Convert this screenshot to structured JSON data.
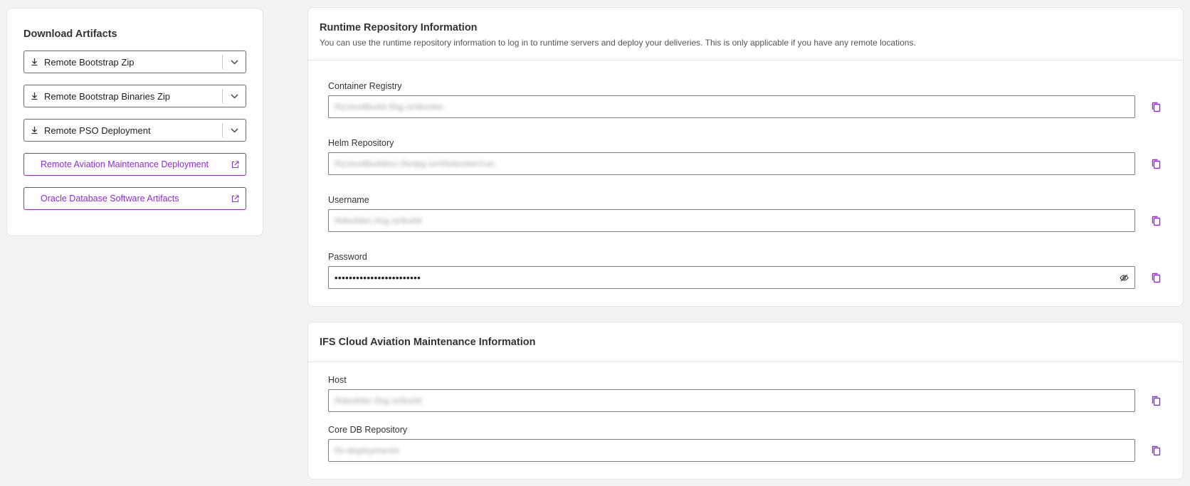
{
  "colors": {
    "accent": "#8a2fd1",
    "background": "#f3f2f4",
    "card": "#ffffff"
  },
  "download_artifacts": {
    "title": "Download Artifacts",
    "split_buttons": [
      {
        "label": "Remote Bootstrap Zip",
        "icon": "download-icon",
        "menu_icon": "chevron-down-icon"
      },
      {
        "label": "Remote Bootstrap Binaries Zip",
        "icon": "download-icon",
        "menu_icon": "chevron-down-icon"
      },
      {
        "label": "Remote PSO Deployment",
        "icon": "download-icon",
        "menu_icon": "chevron-down-icon"
      }
    ],
    "link_buttons": [
      {
        "label": "Remote Aviation Maintenance Deployment",
        "icon": "external-link-icon"
      },
      {
        "label": "Oracle Database Software Artifacts",
        "icon": "external-link-icon"
      }
    ]
  },
  "runtime_repository": {
    "title": "Runtime Repository Information",
    "description": "You can use the runtime repository information to log in to runtime servers and deploy your deliveries. This is only applicable if you have any remote locations.",
    "fields": [
      {
        "label": "Container Registry",
        "value": "ifscloudbuild.ifsg.io/docker"
      },
      {
        "label": "Helm Repository",
        "value": "ifscloudbuildoci.ifsnpg.io/nfsdocker/run"
      },
      {
        "label": "Username",
        "value": "ifsbuilder.ifsg.io/build"
      },
      {
        "label": "Password",
        "value": "••••••••••••••••••••••••",
        "reveal_icon": "eye-slash-icon"
      }
    ],
    "copy_icon": "copy-icon"
  },
  "ifs_cloud": {
    "title": "IFS Cloud Aviation Maintenance Information",
    "fields": [
      {
        "label": "Host",
        "value": "ifsbuilder.ifsg.io/build"
      },
      {
        "label": "Core DB Repository",
        "value": "ifs-deployments"
      }
    ],
    "copy_icon": "copy-icon"
  }
}
